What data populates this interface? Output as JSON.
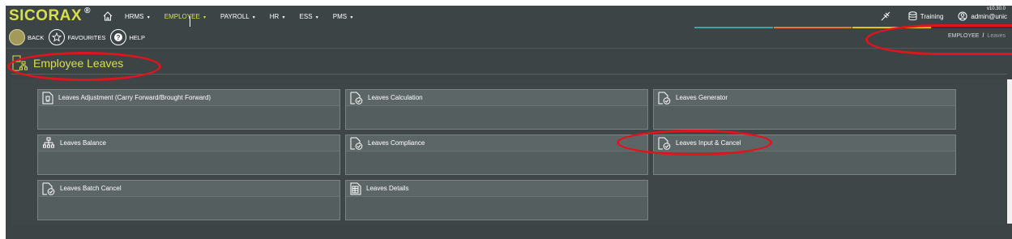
{
  "app": {
    "brand": "SICORAX",
    "brand_mark": "®",
    "version": "v10.30.0"
  },
  "nav": {
    "items": [
      {
        "label": "HRMS",
        "caret": "▾",
        "active": false
      },
      {
        "label": "EMPLOYEE",
        "caret": "▾",
        "active": true
      },
      {
        "label": "PAYROLL",
        "caret": "▾",
        "active": false
      },
      {
        "label": "HR",
        "caret": "▾",
        "active": false
      },
      {
        "label": "ESS",
        "caret": "▾",
        "active": false
      },
      {
        "label": "PMS",
        "caret": "▾",
        "active": false
      }
    ],
    "database_label": "Training",
    "user_label": "admin@unic"
  },
  "toolbar": {
    "back_label": "BACK",
    "favourites_label": "FAVOURITES",
    "help_label": "HELP"
  },
  "breadcrumb": {
    "parent": "EMPLOYEE",
    "separator": "/",
    "current": "Leaves"
  },
  "page": {
    "title": "Employee Leaves"
  },
  "tiles": [
    {
      "label": "Leaves Adjustment (Carry Forward/Brought Forward)",
      "icon": "document-badge-icon"
    },
    {
      "label": "Leaves Calculation",
      "icon": "document-check-icon"
    },
    {
      "label": "Leaves Generator",
      "icon": "document-check-icon"
    },
    {
      "label": "Leaves Balance",
      "icon": "hierarchy-icon"
    },
    {
      "label": "Leaves Compliance",
      "icon": "document-check-icon"
    },
    {
      "label": "Leaves Input & Cancel",
      "icon": "document-check-icon"
    },
    {
      "label": "Leaves Batch Cancel",
      "icon": "document-check-icon"
    },
    {
      "label": "Leaves Details",
      "icon": "document-list-icon"
    }
  ],
  "colors": {
    "accent": "#d7e04b",
    "bar_bg": "#3c4446",
    "tile_bg": "#555e5f",
    "annotation": "#e3131b",
    "progress_teal": "#3aa6a6",
    "progress_orange": "#e5792c",
    "progress_yellow": "#e8c21c"
  }
}
